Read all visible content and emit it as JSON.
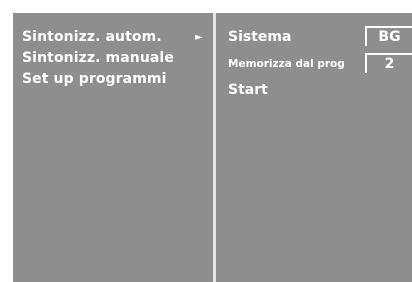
{
  "menu": {
    "items": [
      {
        "label": "Sintonizz. autom."
      },
      {
        "label": "Sintonizz. manuale"
      },
      {
        "label": "Set up programmi"
      }
    ],
    "selected_arrow": "►"
  },
  "submenu": {
    "system_label": "Sistema",
    "system_value": "BG",
    "store_label": "Memorizza dal prog",
    "store_value": "2",
    "start_label": "Start"
  },
  "colors": {
    "background": "#8e8e8e",
    "text": "#ffffff",
    "divider": "#e6e6e6"
  }
}
